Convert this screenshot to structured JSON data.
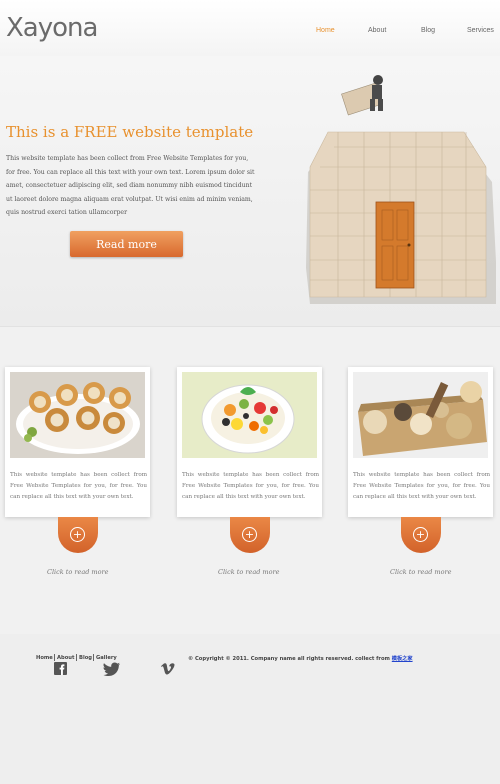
{
  "header": {
    "logo": "Xayona",
    "nav": [
      "Home",
      "About",
      "Blog",
      "Services"
    ]
  },
  "hero": {
    "title": "This is a FREE website template",
    "body": "This website template has been collect from Free Website Templates for you, for free. You can replace all this text with your own text. Lorem ipsum dolor sit amet, consectetuer adipiscing elit, sed diam nonummy nibh euismod tincidunt ut laoreet dolore magna aliquam erat volutpat. Ut wisi enim ad minim veniam, quis nostrud exerci tation ullamcorper",
    "button": "Read more"
  },
  "cards": [
    {
      "image": "pastries",
      "text": "This website template has been collect from Free Website Templates for you, for free. You can replace all this text with your own text.",
      "link": "Click to read more"
    },
    {
      "image": "fruit-salad",
      "text": "This website template has been collect from Free Website Templates for you, for free. You can replace all this text with your own text.",
      "link": "Click to read more"
    },
    {
      "image": "bath-sponges",
      "text": "This website template has been collect from Free Website Templates for you, for free. You can replace all this text with your own text.",
      "link": "Click to read more"
    }
  ],
  "footer": {
    "nav": [
      "Home",
      "About",
      "Blog",
      "Gallery"
    ],
    "social": [
      "facebook-icon",
      "twitter-icon",
      "vimeo-icon"
    ],
    "copyright": "© Copyright © 2011. Company name all rights reserved.  collect from",
    "copyright_link": "模板之家"
  },
  "colors": {
    "accent": "#e8912e",
    "button": "#d8692e",
    "link": "#2244cc"
  }
}
